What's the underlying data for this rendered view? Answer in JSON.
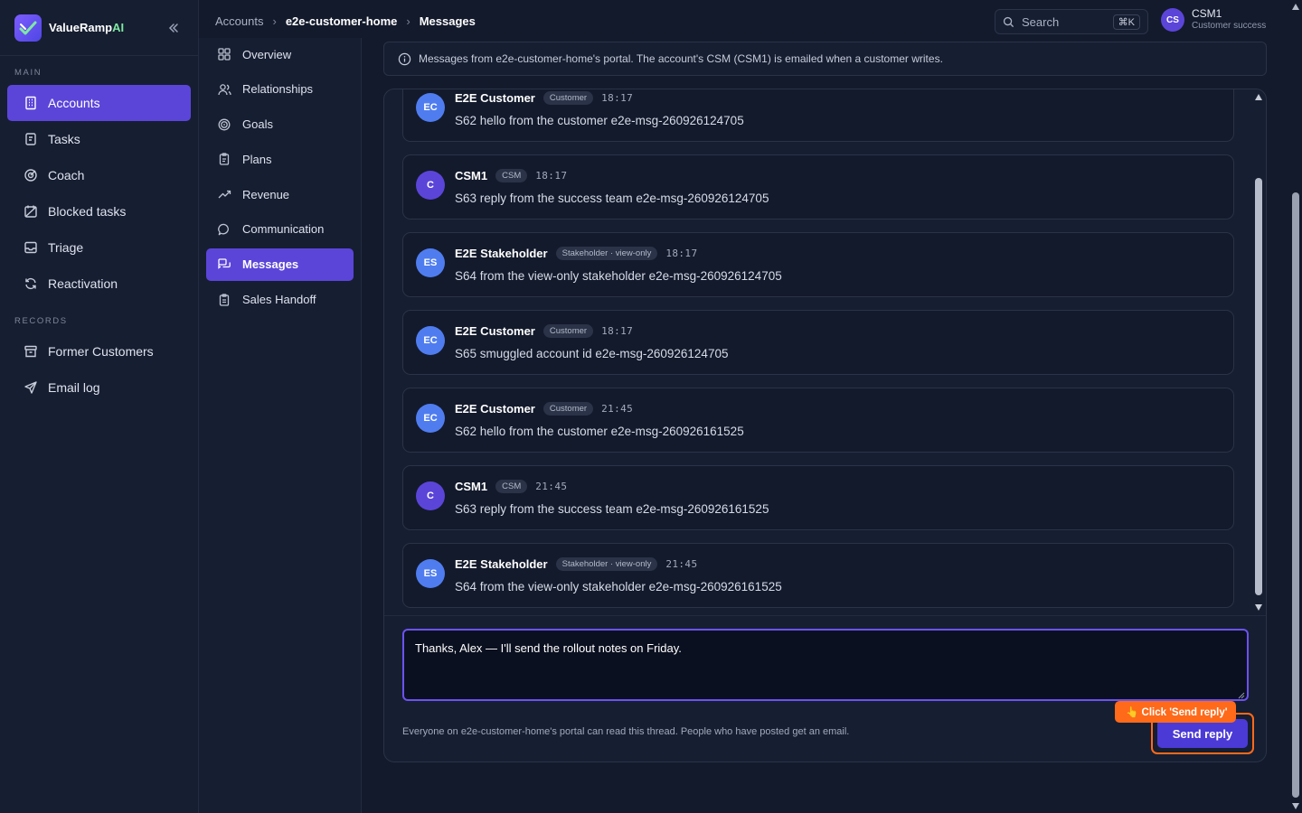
{
  "brand": {
    "name_main": "ValueRamp",
    "name_accent": "AI"
  },
  "sidebar": {
    "main_label": "MAIN",
    "records_label": "RECORDS",
    "main_items": [
      {
        "label": "Accounts",
        "icon": "building-icon",
        "active": true
      },
      {
        "label": "Tasks",
        "icon": "clipboard-icon"
      },
      {
        "label": "Coach",
        "icon": "target-icon"
      },
      {
        "label": "Blocked tasks",
        "icon": "blocked-calendar-icon"
      },
      {
        "label": "Triage",
        "icon": "inbox-icon"
      },
      {
        "label": "Reactivation",
        "icon": "refresh-icon"
      }
    ],
    "record_items": [
      {
        "label": "Former Customers",
        "icon": "archive-icon"
      },
      {
        "label": "Email log",
        "icon": "send-icon"
      }
    ]
  },
  "breadcrumb": [
    "Accounts",
    "e2e-customer-home",
    "Messages"
  ],
  "search": {
    "placeholder": "Search",
    "shortcut": "⌘K"
  },
  "user": {
    "initials": "CS",
    "name": "CSM1",
    "role": "Customer success"
  },
  "subnav": [
    {
      "label": "Overview",
      "icon": "grid-icon"
    },
    {
      "label": "Relationships",
      "icon": "people-icon"
    },
    {
      "label": "Goals",
      "icon": "target-icon"
    },
    {
      "label": "Plans",
      "icon": "clipboard-icon"
    },
    {
      "label": "Revenue",
      "icon": "trending-up-icon"
    },
    {
      "label": "Communication",
      "icon": "chat-bubble-icon"
    },
    {
      "label": "Messages",
      "icon": "messages-icon",
      "active": true
    },
    {
      "label": "Sales Handoff",
      "icon": "clipboard-check-icon"
    }
  ],
  "banner": {
    "text": "Messages from e2e-customer-home's portal. The account's CSM (CSM1) is emailed when a customer writes."
  },
  "messages": [
    {
      "initials": "EC",
      "author": "E2E Customer",
      "role": "Customer",
      "time": "18:17",
      "text": "S62 hello from the customer e2e-msg-260926124705",
      "kind": "cust"
    },
    {
      "initials": "C",
      "author": "CSM1",
      "role": "CSM",
      "time": "18:17",
      "text": "S63 reply from the success team e2e-msg-260926124705",
      "kind": "csm"
    },
    {
      "initials": "ES",
      "author": "E2E Stakeholder",
      "role": "Stakeholder · view-only",
      "time": "18:17",
      "text": "S64 from the view-only stakeholder e2e-msg-260926124705",
      "kind": "cust"
    },
    {
      "initials": "EC",
      "author": "E2E Customer",
      "role": "Customer",
      "time": "18:17",
      "text": "S65 smuggled account id e2e-msg-260926124705",
      "kind": "cust"
    },
    {
      "initials": "EC",
      "author": "E2E Customer",
      "role": "Customer",
      "time": "21:45",
      "text": "S62 hello from the customer e2e-msg-260926161525",
      "kind": "cust"
    },
    {
      "initials": "C",
      "author": "CSM1",
      "role": "CSM",
      "time": "21:45",
      "text": "S63 reply from the success team e2e-msg-260926161525",
      "kind": "csm"
    },
    {
      "initials": "ES",
      "author": "E2E Stakeholder",
      "role": "Stakeholder · view-only",
      "time": "21:45",
      "text": "S64 from the view-only stakeholder e2e-msg-260926161525",
      "kind": "cust"
    }
  ],
  "composer": {
    "value": "Thanks, Alex — I'll send the rollout notes on Friday.",
    "footnote": "Everyone on e2e-customer-home's portal can read this thread. People who have posted get an email.",
    "send_label": "Send reply",
    "hint": "👆 Click 'Send reply'"
  },
  "colors": {
    "accent": "#5b45d9",
    "highlight": "#ff6a1a",
    "background": "#131a2c"
  }
}
